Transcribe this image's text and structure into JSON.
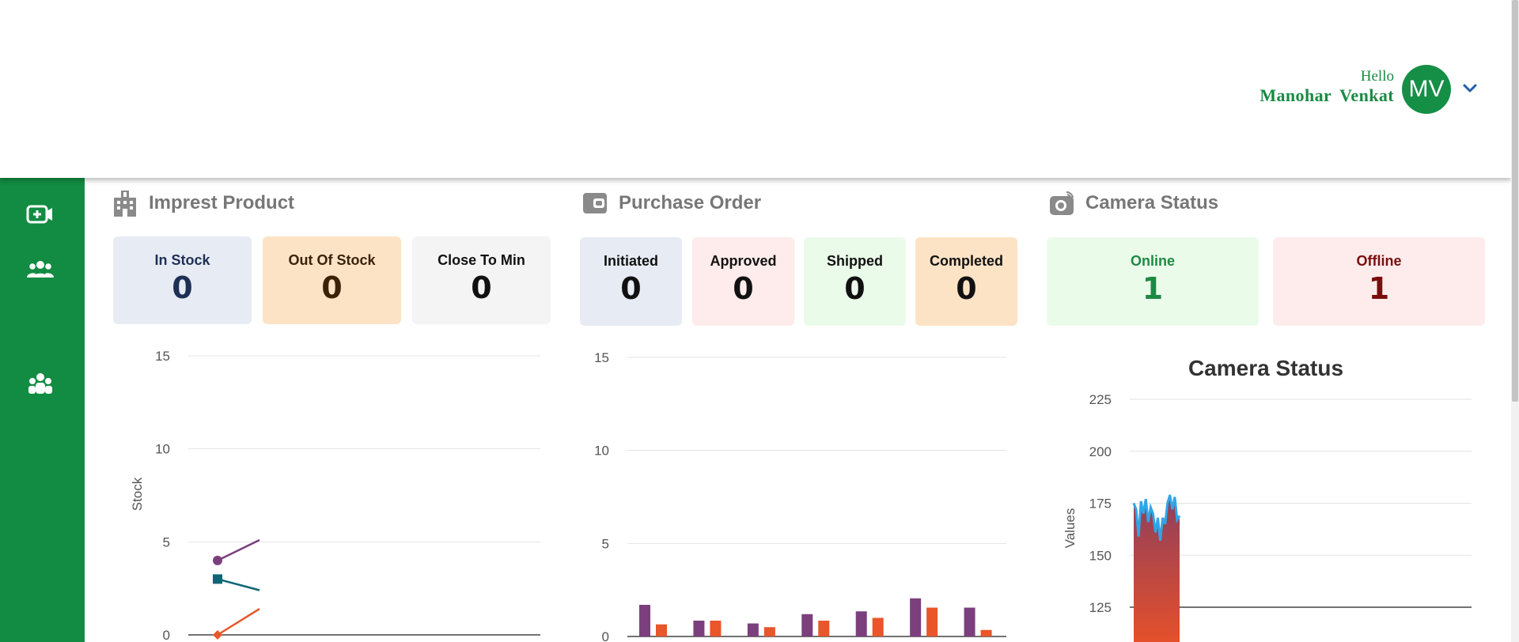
{
  "header": {
    "greeting": "Hello",
    "first_name": "Manohar",
    "last_name": "Venkat",
    "avatar_initials": "MV"
  },
  "sidebar": {
    "items": [
      {
        "icon": "video-plus-icon"
      },
      {
        "icon": "users-icon"
      },
      {
        "icon": "team-icon"
      }
    ],
    "color": "#128c42"
  },
  "impress": {
    "title": "Imprest Product",
    "cards": [
      {
        "label": "In Stock",
        "value": "0"
      },
      {
        "label": "Out Of Stock",
        "value": "0"
      },
      {
        "label": "Close To Min",
        "value": "0"
      }
    ],
    "chart": {
      "ylabel": "Stock",
      "ticks": [
        "15",
        "10",
        "5",
        "0"
      ]
    }
  },
  "purchase": {
    "title": "Purchase Order",
    "cards": [
      {
        "label": "Initiated",
        "value": "0"
      },
      {
        "label": "Approved",
        "value": "0"
      },
      {
        "label": "Shipped",
        "value": "0"
      },
      {
        "label": "Completed",
        "value": "0"
      }
    ],
    "chart": {
      "ticks": [
        "15",
        "10",
        "5",
        "0"
      ]
    }
  },
  "camera": {
    "title": "Camera Status",
    "cards": [
      {
        "label": "Online",
        "value": "1"
      },
      {
        "label": "Offline",
        "value": "1"
      }
    ],
    "chart": {
      "title": "Camera Status",
      "ylabel": "Values",
      "ticks": [
        "225",
        "200",
        "175",
        "150",
        "125"
      ]
    }
  },
  "chart_data": [
    {
      "type": "line",
      "ylabel": "Stock",
      "ylim": [
        0,
        15
      ],
      "yticks": [
        0,
        5,
        10,
        15
      ],
      "series": [
        {
          "color": "#7b3f7e",
          "marker": "circle",
          "values": [
            4,
            5.1
          ]
        },
        {
          "color": "#0e6675",
          "marker": "square",
          "values": [
            3,
            2.4
          ]
        },
        {
          "color": "#e8562a",
          "marker": "diamond",
          "values": [
            0,
            1.4
          ]
        }
      ]
    },
    {
      "type": "bar",
      "ylim": [
        0,
        15
      ],
      "yticks": [
        0,
        5,
        10,
        15
      ],
      "series": [
        {
          "color": "#7b3f7e",
          "values": [
            1.7,
            0.85,
            0.7,
            1.2,
            1.35,
            2.05,
            1.55
          ]
        },
        {
          "color": "#e8562a",
          "values": [
            0.65,
            0.85,
            0.5,
            0.85,
            1.0,
            1.55,
            0.35
          ]
        }
      ]
    },
    {
      "type": "area",
      "title": "Camera Status",
      "ylabel": "Values",
      "ylim": [
        115,
        230
      ],
      "yticks": [
        125,
        150,
        175,
        200,
        225
      ],
      "series": [
        {
          "color": "#2fa6e8",
          "values": [
            175,
            172,
            159,
            176,
            170,
            177,
            166,
            173,
            170,
            161,
            168,
            157,
            168,
            165,
            175,
            179,
            172,
            178,
            167,
            169
          ]
        }
      ]
    }
  ]
}
